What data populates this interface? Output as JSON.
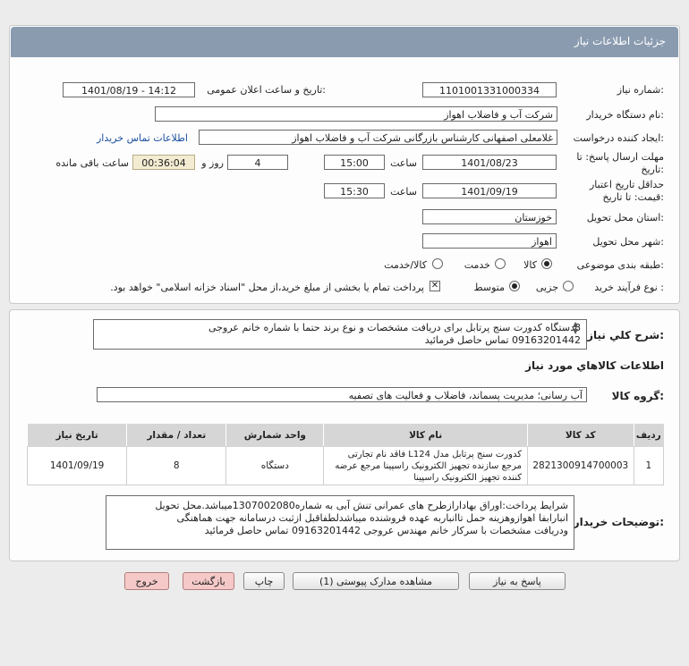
{
  "header": {
    "title": "جزئیات اطلاعات نیاز"
  },
  "watermark": {
    "brand": "ParsNamadData",
    "subtitle": "پایگاه اطلاع رسانی مناقصات و مزایدات"
  },
  "labels": {
    "need_number": "شماره نیاز:",
    "announce_datetime": "تاریخ و ساعت اعلان عمومی:",
    "buyer_name": "نام دستگاه خریدار:",
    "requester": "ایجاد کننده درخواست:",
    "contact_link": "اطلاعات تماس خریدار",
    "reply_deadline": "مهلت ارسال پاسخ: تا تاریخ:",
    "validity_deadline": "حداقل تاریخ اعتبار قیمت: تا تاریخ:",
    "time": "ساعت",
    "day_and": "روز و",
    "remaining": "ساعت باقی مانده",
    "province": "استان محل تحویل:",
    "city": "شهر محل تحویل:",
    "category": "طبقه بندی موضوعی:",
    "process": "نوع فرآیند خرید :",
    "summary": "شرح کلي نياز:",
    "goods_info": "اطلاعات کالاهاي مورد نياز",
    "goods_group": "گروه کالا:",
    "buyer_notes": "توضیحات خریدار:"
  },
  "values": {
    "need_number": "1101001331000334",
    "announce_datetime": "1401/08/19 - 14:12",
    "buyer_name": "شرکت آب و فاضلاب اهواز",
    "requester": "غلامعلی اصفهانی کارشناس بازرگانی شرکت آب و فاضلاب اهواز",
    "reply_date": "1401/08/23",
    "reply_time": "15:00",
    "reply_days": "4",
    "remaining_time": "00:36:04",
    "validity_date": "1401/09/19",
    "validity_time": "15:30",
    "province": "خوزستان",
    "city": "اهواز",
    "summary_line1": "8دستگاه کدورت سنج پرتابل برای دریافت مشخصات و نوع برند حتما با شماره خانم عروجی",
    "summary_line2": "09163201442 تماس حاصل فرمائید",
    "goods_group": "آب رسانی؛ مدیریت پسماند، فاضلاب و فعالیت های تصفیه",
    "notes_line1": "شرایط پرداخت:اوراق بهادارازطرح های عمرانی تنش آبی به شماره1307002080میباشد.محل تحویل",
    "notes_line2": "انبارابفا اهوازوهزینه حمل تاانباربه عهده فروشنده میباشدلطفاقبل ازثبت درسامانه جهت هماهنگی",
    "notes_line3": "ودریافت مشخصات با سرکار خانم مهندس عروجی 09163201442 تماس حاصل فرمائید"
  },
  "category_options": [
    {
      "label": "کالا",
      "selected": true
    },
    {
      "label": "خدمت",
      "selected": false
    },
    {
      "label": "کالا/خدمت",
      "selected": false
    }
  ],
  "process_options": [
    {
      "label": "جزیی",
      "selected": false
    },
    {
      "label": "متوسط",
      "selected": true
    }
  ],
  "process_note": "پرداخت تمام یا بخشی از مبلغ خرید،از محل \"اسناد خزانه اسلامی\" خواهد بود.",
  "table": {
    "headers": [
      "ردیف",
      "کد کالا",
      "نام کالا",
      "واحد شمارش",
      "تعداد / مقدار",
      "تاریخ نیاز"
    ],
    "rows": [
      [
        "1",
        "2821300914700003",
        "کدورت سنج پرتابل مدل L124 فاقد نام تجارتی مرجع سازنده تجهیز الکترونیک راسپینا مرجع عرضه کننده تجهیز الکترونیک راسپینا",
        "دستگاه",
        "8",
        "1401/09/19"
      ]
    ]
  },
  "buttons": {
    "reply": "پاسخ به نیاز",
    "attachments": "مشاهده مدارک پیوستی (1)",
    "print": "چاپ",
    "back": "بازگشت",
    "exit": "خروج"
  }
}
